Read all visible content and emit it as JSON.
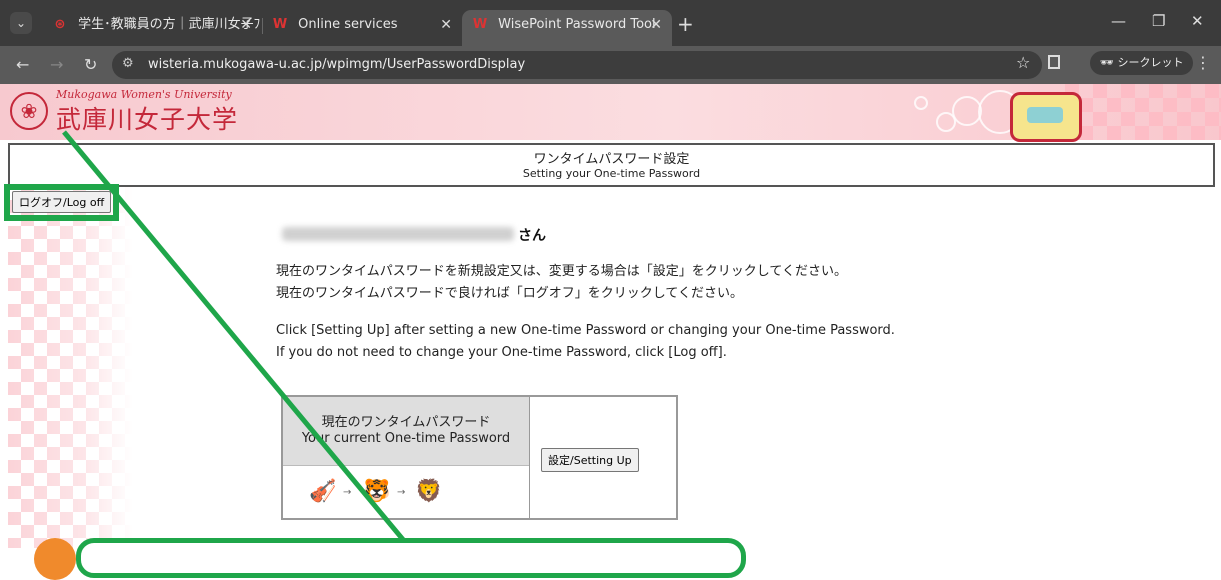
{
  "browser": {
    "tabs": [
      {
        "label": "学生･教職員の方｜武庫川女子ﾌ",
        "favicon": "mukogawa-logo",
        "active": false
      },
      {
        "label": "Online services",
        "favicon": "w-icon",
        "active": false
      },
      {
        "label": "WisePoint Password Tool",
        "favicon": "w-icon",
        "active": true
      }
    ],
    "url": "wisteria.mukogawa-u.ac.jp/wpimgm/UserPasswordDisplay",
    "incognito_label": "シークレット"
  },
  "banner": {
    "univ_name_en": "Mukogawa Women's University",
    "univ_name_ja": "武庫川女子大学"
  },
  "title": {
    "ja": "ワンタイムパスワード設定",
    "en": "Setting your One-time Password"
  },
  "logoff_label": "ログオフ/Log off",
  "greeting_suffix": "さん",
  "instructions": {
    "ja_line1": "現在のワンタイムパスワードを新規設定又は、変更する場合は「設定」をクリックしてください。",
    "ja_line2": "現在のワンタイムパスワードで良ければ「ログオフ」をクリックしてください。",
    "en_line1": "Click [Setting Up] after setting a new One-time Password or changing your One-time Password.",
    "en_line2": "If you do not need to change your One-time Password, click [Log off]."
  },
  "password_table": {
    "header_ja": "現在のワンタイムパスワード",
    "header_en": "Your current One-time Password",
    "icons": [
      "violin-icon",
      "tiger-icon",
      "lion-icon"
    ],
    "setup_label": "設定/Setting Up"
  },
  "colors": {
    "brand": "#c4283a",
    "highlight": "#1fa64a",
    "badge": "#f08a2c"
  }
}
